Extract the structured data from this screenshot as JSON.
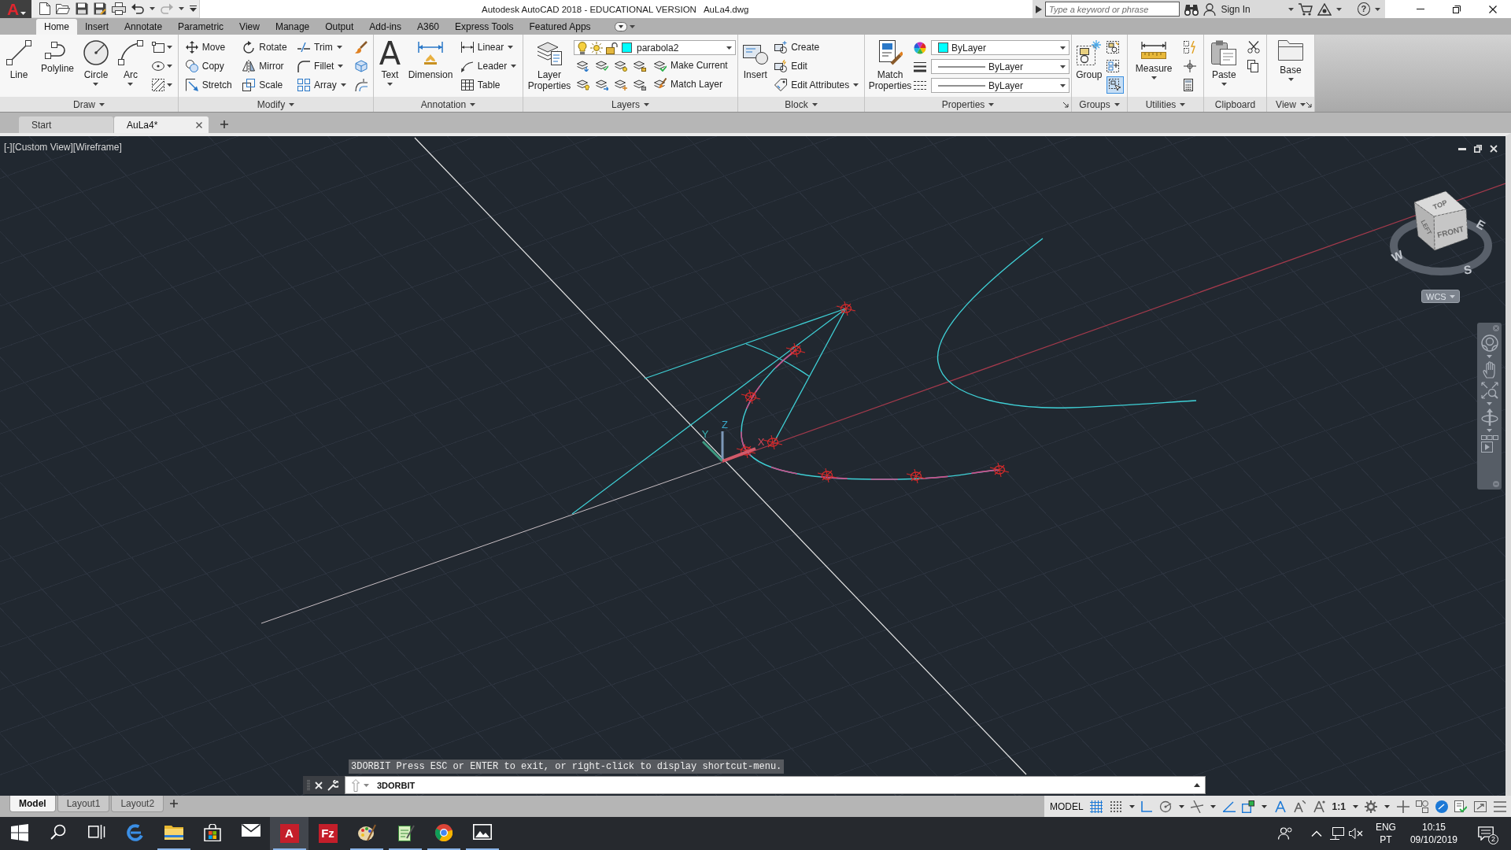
{
  "title_bar": {
    "app_button": "A",
    "quick_access": [
      {
        "disabled": false,
        "dropdown": false
      },
      {
        "disabled": false,
        "dropdown": false
      },
      {
        "disabled": false,
        "dropdown": false
      },
      {
        "disabled": false,
        "dropdown": false
      },
      {
        "disabled": false,
        "dropdown": false
      },
      {
        "disabled": false,
        "dropdown": true
      },
      {
        "disabled": true,
        "dropdown": true
      }
    ],
    "title": "Autodesk AutoCAD 2018 - EDUCATIONAL VERSION",
    "file_name": "AuLa4.dwg",
    "search": {
      "placeholder": "Type a keyword or phrase"
    },
    "sign_in": "Sign In",
    "help": "?"
  },
  "ribbon_tabs": [
    {
      "label": "Home",
      "selected": true
    },
    {
      "label": "Insert",
      "selected": false
    },
    {
      "label": "Annotate",
      "selected": false
    },
    {
      "label": "Parametric",
      "selected": false
    },
    {
      "label": "View",
      "selected": false
    },
    {
      "label": "Manage",
      "selected": false
    },
    {
      "label": "Output",
      "selected": false
    },
    {
      "label": "Add-ins",
      "selected": false
    },
    {
      "label": "A360",
      "selected": false
    },
    {
      "label": "Express Tools",
      "selected": false
    },
    {
      "label": "Featured Apps",
      "selected": false
    }
  ],
  "ribbon_panels": [
    {
      "title": "Draw",
      "menu": true,
      "tools": [
        {
          "kind": "large",
          "label": "Line",
          "dropdown": false
        },
        {
          "kind": "large",
          "label": "Polyline",
          "dropdown": false
        },
        {
          "kind": "large",
          "label": "Circle",
          "dropdown": true
        },
        {
          "kind": "large",
          "label": "Arc",
          "dropdown": true
        },
        {
          "kind": "stack",
          "items": [
            {
              "dropdown": true
            },
            {
              "dropdown": true
            },
            {
              "dropdown": true
            }
          ]
        }
      ]
    },
    {
      "title": "Modify",
      "menu": true,
      "tools": [
        {
          "kind": "stack",
          "items": [
            {
              "label": "Move",
              "dropdown": false
            },
            {
              "label": "Copy",
              "dropdown": false
            },
            {
              "label": "Stretch",
              "dropdown": false
            }
          ]
        },
        {
          "kind": "stack",
          "items": [
            {
              "label": "Rotate",
              "dropdown": false
            },
            {
              "label": "Mirror",
              "dropdown": false
            },
            {
              "label": "Scale",
              "dropdown": false
            }
          ]
        },
        {
          "kind": "stack",
          "items": [
            {
              "label": "Trim",
              "dropdown": true
            },
            {
              "label": "Fillet",
              "dropdown": true
            },
            {
              "label": "Array",
              "dropdown": true
            }
          ]
        },
        {
          "kind": "stack",
          "items": [
            {
              "dropdown": false
            },
            {
              "dropdown": false
            },
            {
              "dropdown": false
            }
          ]
        }
      ]
    },
    {
      "title": "Annotation",
      "menu": true,
      "tools": [
        {
          "kind": "large",
          "label": "Text",
          "glyph": "A",
          "dropdown": true
        },
        {
          "kind": "large",
          "label": "Dimension",
          "dropdown": false
        },
        {
          "kind": "stack",
          "items": [
            {
              "label": "Linear",
              "dropdown": true
            },
            {
              "label": "Leader",
              "dropdown": true
            },
            {
              "label": "Table",
              "dropdown": false
            }
          ]
        }
      ]
    },
    {
      "title": "Layers",
      "menu": true,
      "tools": [
        {
          "kind": "large",
          "label": "Layer Properties",
          "dropdown": false
        },
        {
          "kind": "layer_block",
          "current_layer": "parabola2",
          "actions": [
            {
              "label": "Make Current"
            },
            {
              "label": "Match Layer"
            }
          ]
        }
      ]
    },
    {
      "title": "Block",
      "menu": true,
      "tools": [
        {
          "kind": "large",
          "label": "Insert",
          "dropdown": false
        },
        {
          "kind": "stack",
          "items": [
            {
              "label": "Create",
              "dropdown": false
            },
            {
              "label": "Edit",
              "dropdown": false
            },
            {
              "label": "Edit Attributes",
              "dropdown": true
            }
          ]
        }
      ]
    },
    {
      "title": "Properties",
      "menu": true,
      "launcher": true,
      "tools": [
        {
          "kind": "large",
          "label": "Match Properties",
          "dropdown": false
        },
        {
          "kind": "properties",
          "rows": [
            {
              "kind": "color",
              "value": "ByLayer"
            },
            {
              "kind": "lineweight",
              "value": "ByLayer"
            },
            {
              "kind": "linetype",
              "value": "ByLayer"
            }
          ]
        }
      ]
    },
    {
      "title": "Groups",
      "menu": true,
      "tools": [
        {
          "kind": "large",
          "label": "Group",
          "dropdown": false
        },
        {
          "kind": "stack",
          "items": [
            {
              "dropdown": false,
              "active": false
            },
            {
              "dropdown": false,
              "active": false
            },
            {
              "dropdown": false,
              "active": true
            }
          ]
        }
      ]
    },
    {
      "title": "Utilities",
      "menu": true,
      "tools": [
        {
          "kind": "large",
          "label": "Measure",
          "dropdown": true
        },
        {
          "kind": "stack",
          "items": [
            {
              "dropdown": false
            },
            {
              "dropdown": false
            },
            {
              "dropdown": false
            }
          ]
        }
      ]
    },
    {
      "title": "Clipboard",
      "menu": false,
      "tools": [
        {
          "kind": "large",
          "label": "Paste",
          "dropdown": true
        },
        {
          "kind": "stack",
          "items": [
            {
              "dropdown": false
            },
            {
              "dropdown": false
            }
          ]
        }
      ]
    },
    {
      "title": "View",
      "menu": true,
      "launcher": true,
      "tools": [
        {
          "kind": "large",
          "label": "Base",
          "dropdown": true
        }
      ]
    }
  ],
  "file_tabs": [
    {
      "label": "Start",
      "selected": false,
      "closable": false
    },
    {
      "label": "AuLa4*",
      "selected": true,
      "closable": true
    }
  ],
  "viewport": {
    "controls": [
      "[-]",
      "[Custom View]",
      "[Wireframe]"
    ],
    "ucs_axes": [
      "X",
      "Y",
      "Z"
    ],
    "view_cube": {
      "faces": [
        "TOP",
        "LEFT",
        "FRONT"
      ],
      "compass": [
        "W",
        "E",
        "S"
      ],
      "ucs_menu": "WCS"
    }
  },
  "command_line": {
    "history": "3DORBIT Press ESC or ENTER to exit, or right-click to display shortcut-menu.",
    "input": "3DORBIT"
  },
  "layout_tabs": [
    {
      "label": "Model",
      "selected": true
    },
    {
      "label": "Layout1",
      "selected": false
    },
    {
      "label": "Layout2",
      "selected": false
    }
  ],
  "status_bar": {
    "space": "MODEL",
    "tools": [
      {
        "kind": "toggle",
        "on": true,
        "dropdown": false
      },
      {
        "kind": "toggle",
        "on": false,
        "dropdown": true
      },
      {
        "kind": "toggle",
        "on": true,
        "dropdown": false
      },
      {
        "kind": "toggle",
        "on": false,
        "dropdown": true
      },
      {
        "kind": "toggle",
        "on": false,
        "dropdown": true
      },
      {
        "kind": "toggle",
        "on": true,
        "dropdown": false
      },
      {
        "kind": "toggle",
        "on": true,
        "dropdown": true
      },
      {
        "kind": "toggle",
        "on": true,
        "dropdown": false
      },
      {
        "kind": "toggle",
        "on": false,
        "dropdown": false
      },
      {
        "kind": "toggle",
        "on": false,
        "dropdown": false
      },
      {
        "kind": "scale",
        "label": "1:1",
        "dropdown": true
      },
      {
        "kind": "toggle",
        "on": false,
        "dropdown": true
      },
      {
        "kind": "toggle",
        "on": false,
        "dropdown": false
      },
      {
        "kind": "toggle",
        "on": false,
        "dropdown": false
      },
      {
        "kind": "toggle",
        "on": true,
        "dropdown": false
      },
      {
        "kind": "toggle",
        "on": false,
        "dropdown": false
      },
      {
        "kind": "toggle",
        "on": false,
        "dropdown": false
      },
      {
        "kind": "toggle",
        "on": false,
        "dropdown": false
      }
    ]
  },
  "taskbar": {
    "apps": [
      {
        "open": false,
        "active": false
      },
      {
        "open": true,
        "active": false
      },
      {
        "open": false,
        "active": false
      },
      {
        "open": false,
        "active": false
      },
      {
        "open": true,
        "active": true,
        "glyph": "A"
      },
      {
        "open": false,
        "active": false,
        "glyph": "Fz"
      },
      {
        "open": true,
        "active": false
      },
      {
        "open": true,
        "active": false
      },
      {
        "open": true,
        "active": false
      },
      {
        "open": true,
        "active": false
      }
    ],
    "language": [
      "ENG",
      "PT"
    ],
    "time": "10:15",
    "date": "09/10/2019",
    "notifications": "2"
  }
}
